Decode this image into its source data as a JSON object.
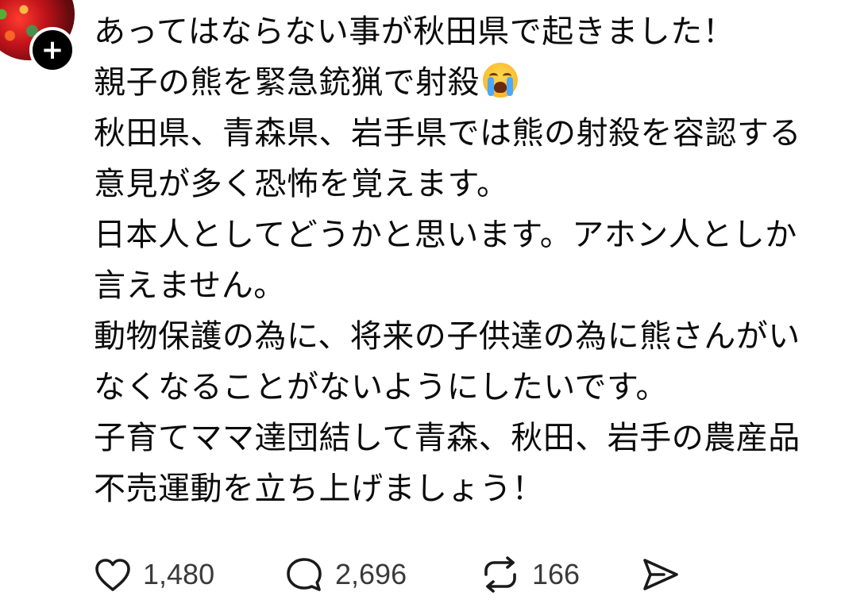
{
  "author": {
    "avatar_icon": "avatar-image",
    "follow_badge": "+"
  },
  "post": {
    "lines": [
      "あってはならない事が秋田県で起きました！",
      "親子の熊を緊急銃猟で射殺",
      "秋田県、青森県、岩手県では熊の射殺を容認する",
      "意見が多く恐怖を覚えます。",
      "日本人としてどうかと思います。アホン人としか",
      "言えません。",
      "動物保護の為に、将来の子供達の為に熊さんがい",
      "なくなることがないようにしたいです。",
      "子育てママ達団結して青森、秋田、岩手の農産品",
      "不売運動を立ち上げましょう！"
    ],
    "emoji": "loudly-crying-face-emoji"
  },
  "actions": {
    "likes": "1,480",
    "replies": "2,696",
    "reposts": "166",
    "like_icon": "heart-icon",
    "reply_icon": "comment-icon",
    "repost_icon": "repost-icon",
    "share_icon": "send-icon"
  },
  "colors": {
    "text": "#0b0b0b",
    "count": "#3a3a3a",
    "icon": "#1a1a1a",
    "badge": "#000000"
  }
}
